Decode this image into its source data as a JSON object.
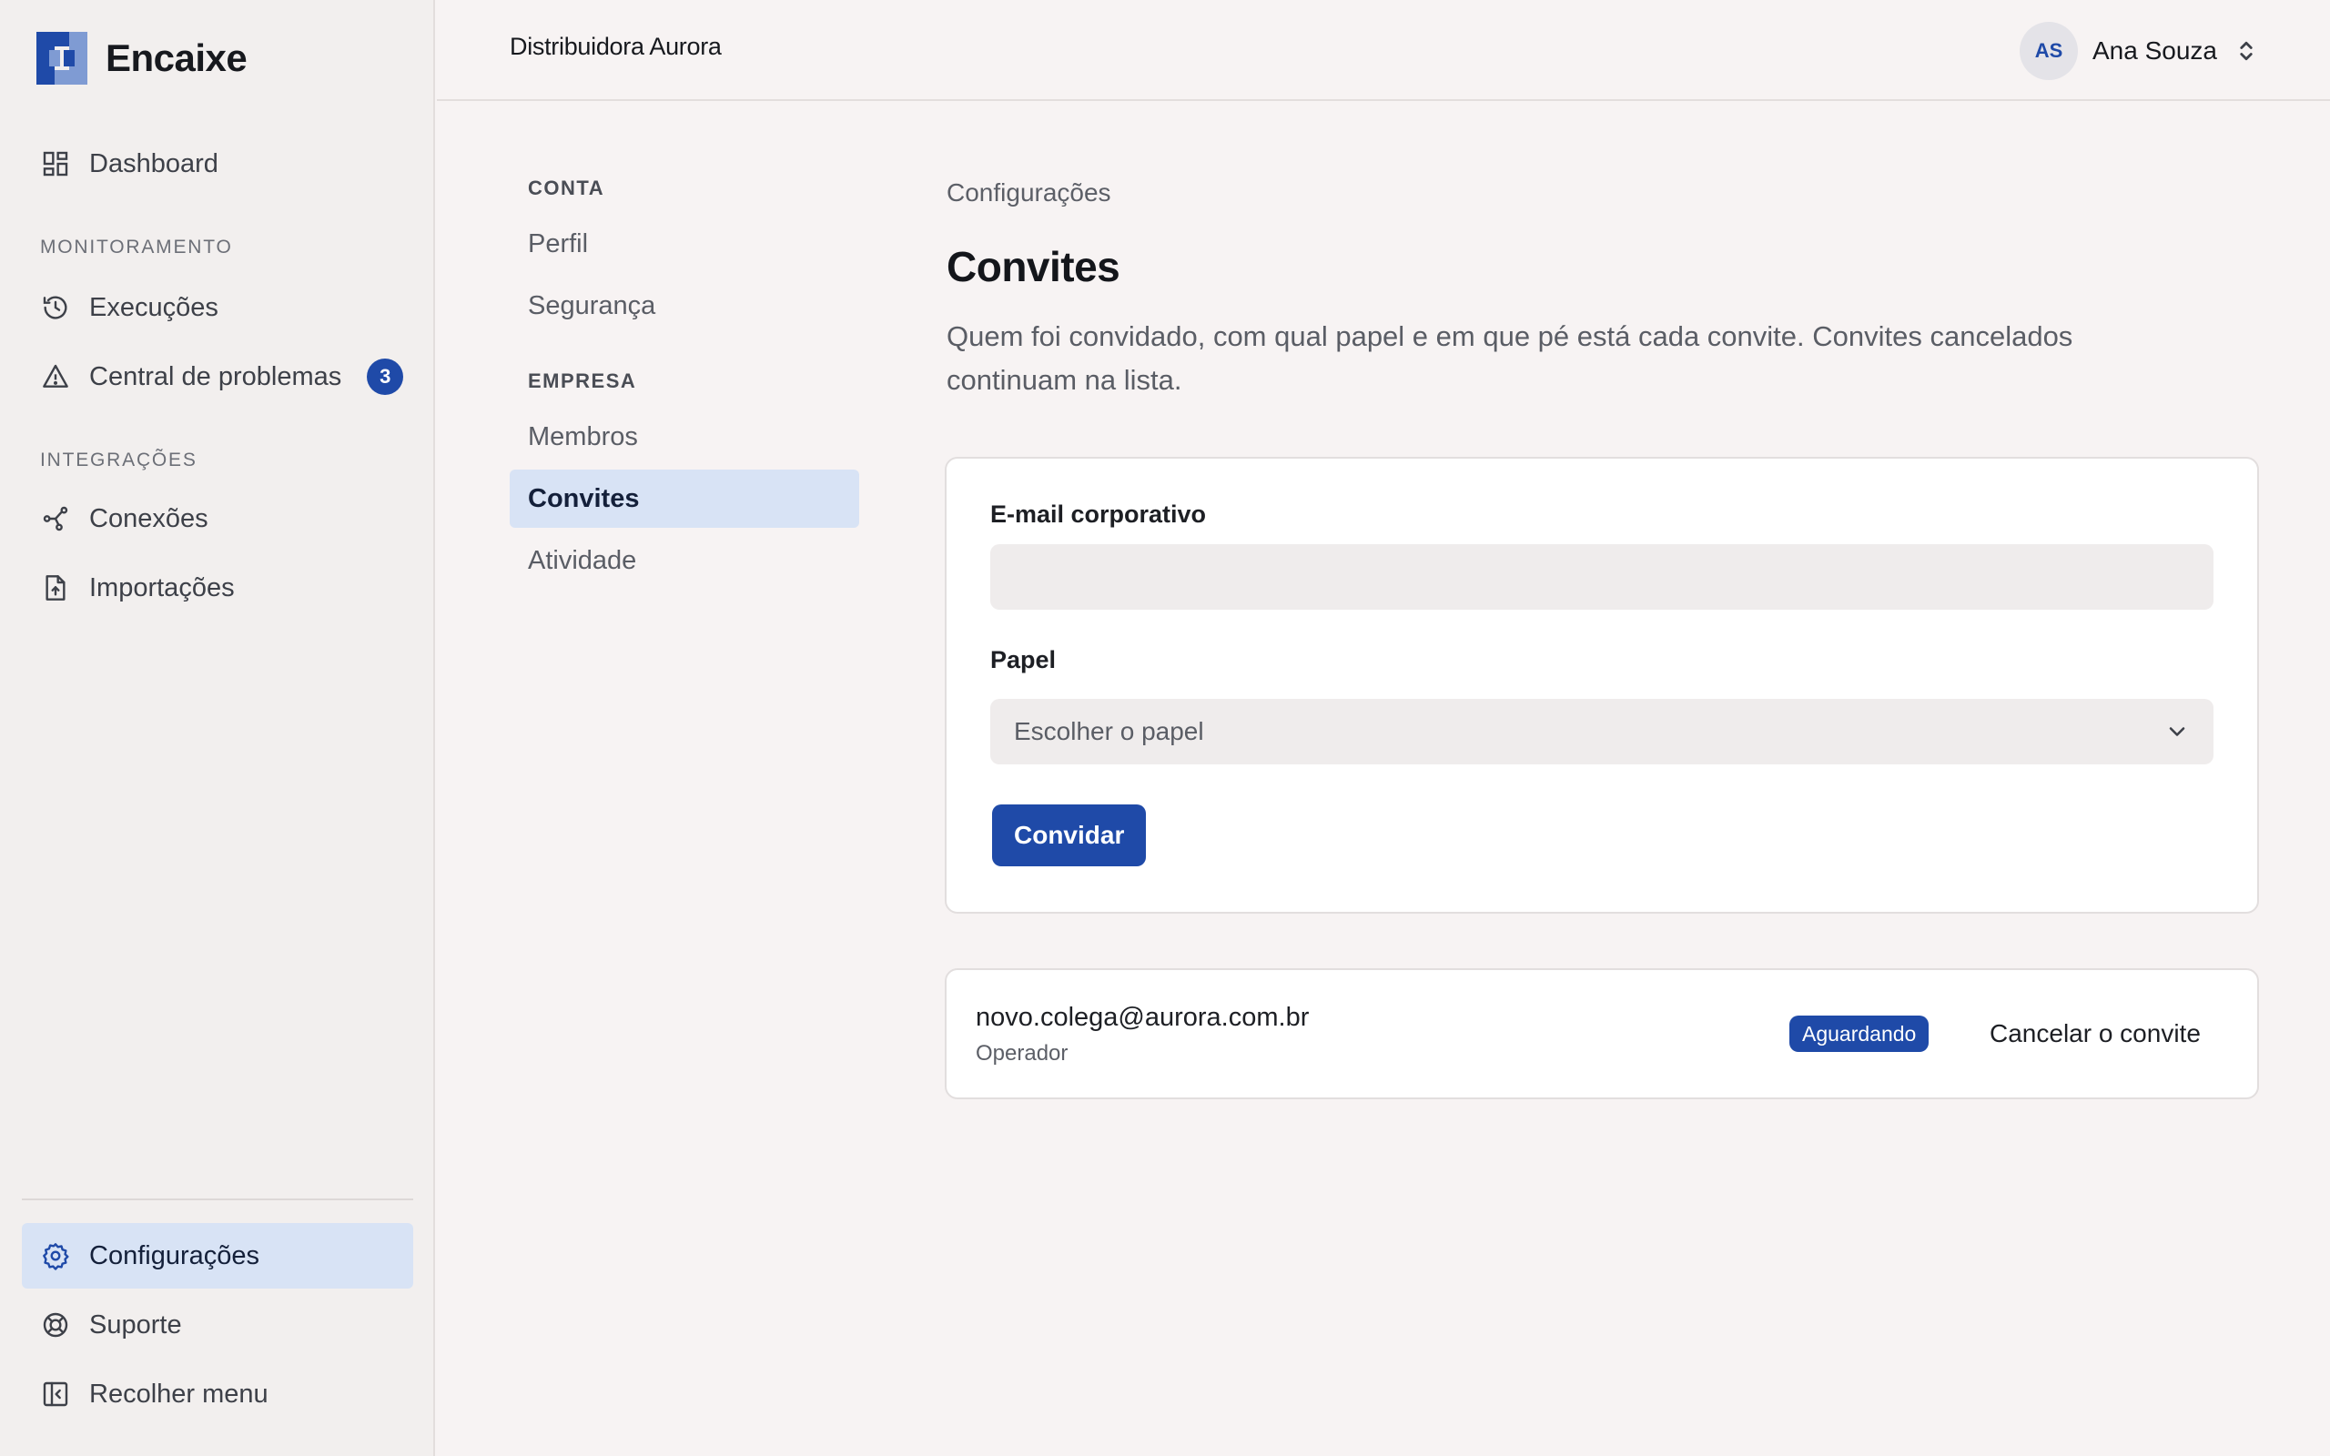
{
  "app": {
    "name": "Encaixe"
  },
  "sidebar": {
    "dashboard": {
      "label": "Dashboard",
      "icon": "dashboard-icon"
    },
    "sections": {
      "monitoring": "MONITORAMENTO",
      "integrations": "INTEGRAÇÕES"
    },
    "executions": {
      "label": "Execuções",
      "icon": "history-icon"
    },
    "problems": {
      "label": "Central de problemas",
      "icon": "warning-icon",
      "badge": "3"
    },
    "connections": {
      "label": "Conexões",
      "icon": "connections-icon"
    },
    "imports": {
      "label": "Importações",
      "icon": "file-upload-icon"
    },
    "settings": {
      "label": "Configurações",
      "icon": "gear-icon",
      "active": true
    },
    "support": {
      "label": "Suporte",
      "icon": "lifebuoy-icon"
    },
    "collapse": {
      "label": "Recolher menu",
      "icon": "collapse-sidebar-icon"
    }
  },
  "topbar": {
    "org_name": "Distribuidora Aurora",
    "user": {
      "initials": "AS",
      "name": "Ana Souza"
    }
  },
  "subnav": {
    "account_section": "CONTA",
    "profile": "Perfil",
    "security": "Segurança",
    "company_section": "EMPRESA",
    "members": "Membros",
    "invites": "Convites",
    "activity": "Atividade"
  },
  "main": {
    "breadcrumb": "Configurações",
    "title": "Convites",
    "description": "Quem foi convidado, com qual papel e em que pé está cada convite. Convites cancelados continuam na lista.",
    "form": {
      "email_label": "E-mail corporativo",
      "email_value": "",
      "role_label": "Papel",
      "role_placeholder": "Escolher o papel",
      "submit_label": "Convidar"
    },
    "invites": [
      {
        "email": "novo.colega@aurora.com.br",
        "role": "Operador",
        "status": "Aguardando",
        "action": "Cancelar o convite"
      }
    ]
  },
  "colors": {
    "accent": "#1f4aa8",
    "active_bg": "#d8e3f5",
    "page_bg": "#f7f3f3",
    "sidebar_bg": "#f2efee"
  }
}
